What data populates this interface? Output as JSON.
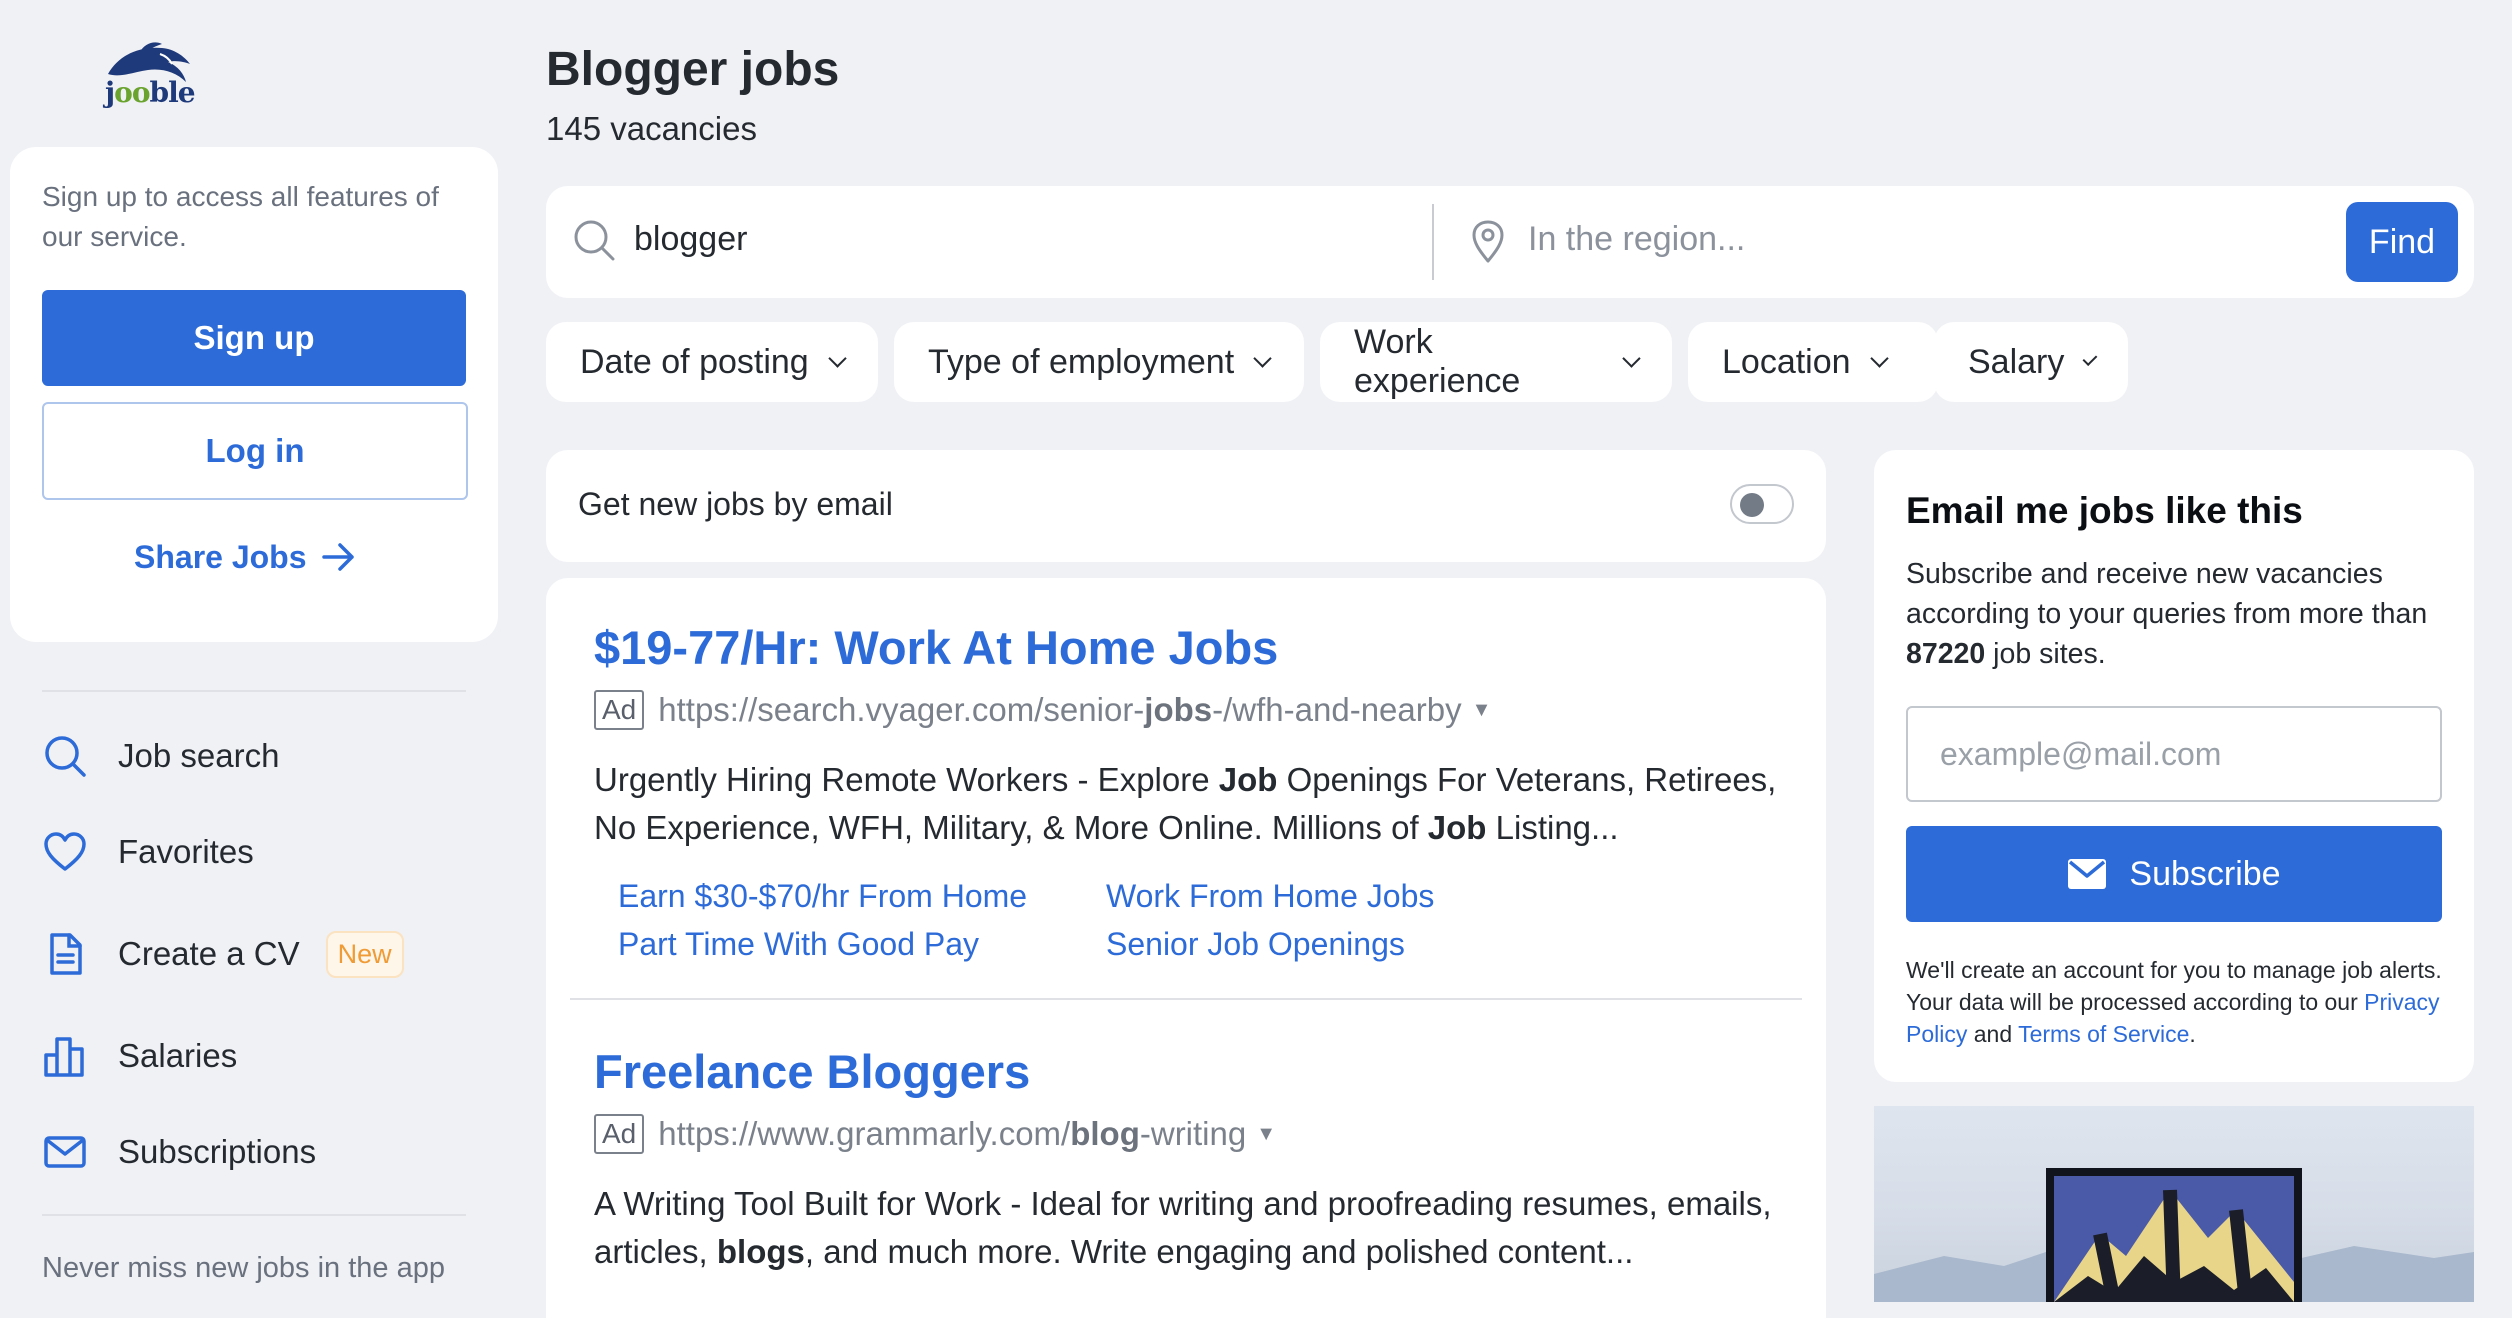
{
  "logo": {
    "text_left": "j",
    "text_oo": "oo",
    "text_right": "ble"
  },
  "sidebar": {
    "prompt": "Sign up to access all features of our service.",
    "signup_label": "Sign up",
    "login_label": "Log in",
    "share_label": "Share Jobs",
    "nav": [
      {
        "label": "Job search",
        "icon": "search-icon"
      },
      {
        "label": "Favorites",
        "icon": "heart-icon"
      },
      {
        "label": "Create a CV",
        "icon": "document-icon",
        "badge": "New"
      },
      {
        "label": "Salaries",
        "icon": "bar-chart-icon"
      },
      {
        "label": "Subscriptions",
        "icon": "envelope-icon"
      }
    ],
    "app_hint": "Never miss new jobs in the app"
  },
  "header": {
    "title": "Blogger jobs",
    "vacancies": "145 vacancies"
  },
  "search": {
    "query": "blogger",
    "region_placeholder": "In the region...",
    "find_label": "Find"
  },
  "filters": [
    "Date of posting",
    "Type of employment",
    "Work experience",
    "Location",
    "Salary"
  ],
  "email_toggle": {
    "label": "Get new jobs by email",
    "enabled": false
  },
  "ads": [
    {
      "title": "$19-77/Hr: Work At Home Jobs",
      "badge": "Ad",
      "url_pre": "https://search.vyager.com/senior-",
      "url_bold": "jobs",
      "url_post": "-/wfh-and-nearby",
      "desc": [
        {
          "t": "Urgently Hiring Remote Workers - Explore ",
          "b": false
        },
        {
          "t": "Job",
          "b": true
        },
        {
          "t": " Openings For Veterans, Retirees, No Experience, WFH, Military, & More Online. Millions of ",
          "b": false
        },
        {
          "t": "Job",
          "b": true
        },
        {
          "t": " Listing...",
          "b": false
        }
      ],
      "links": [
        "Earn $30-$70/hr From Home",
        "Work From Home Jobs",
        "Part Time With Good Pay",
        "Senior Job Openings"
      ]
    },
    {
      "title": "Freelance Bloggers",
      "badge": "Ad",
      "url_pre": "https://www.grammarly.com/",
      "url_bold": "blog",
      "url_post": "-writing",
      "desc": [
        {
          "t": "A Writing Tool Built for Work - Ideal for writing and proofreading resumes, emails, articles, ",
          "b": false
        },
        {
          "t": "blogs",
          "b": true
        },
        {
          "t": ", and much more. Write engaging and polished content...",
          "b": false
        }
      ]
    }
  ],
  "subscribe": {
    "title": "Email me jobs like this",
    "desc_pre": "Subscribe and receive new vacancies according to your queries from more than ",
    "desc_num": "87220",
    "desc_post": " job sites.",
    "email_placeholder": "example@mail.com",
    "button_label": "Subscribe",
    "legal_pre": "We'll create an account for you to manage job alerts. Your data will be processed according to our ",
    "privacy_label": "Privacy Policy",
    "legal_mid": " and ",
    "terms_label": "Terms of Service",
    "legal_end": "."
  },
  "colors": {
    "accent": "#2c6bd8",
    "background": "#f0f1f5",
    "badge_new": "#ef9b36"
  }
}
